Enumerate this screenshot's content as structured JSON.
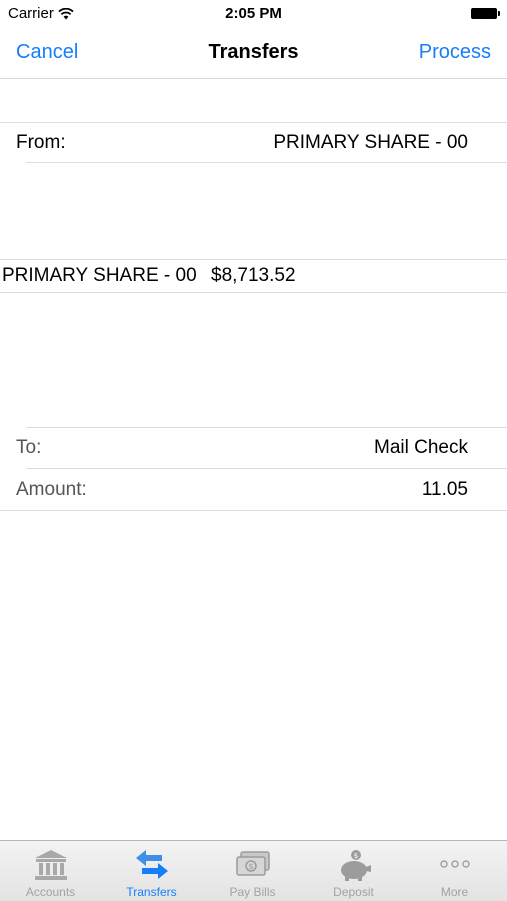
{
  "status_bar": {
    "carrier": "Carrier",
    "time": "2:05 PM"
  },
  "nav": {
    "cancel_label": "Cancel",
    "title": "Transfers",
    "process_label": "Process"
  },
  "from": {
    "label": "From:",
    "value": "PRIMARY SHARE - 00"
  },
  "picker": {
    "account_name": "PRIMARY SHARE - 00",
    "balance": "$8,713.52"
  },
  "to": {
    "label": "To:",
    "value": "Mail Check"
  },
  "amount": {
    "label": "Amount:",
    "value": "11.05"
  },
  "tabs": [
    {
      "label": "Accounts",
      "icon": "bank-icon",
      "active": false
    },
    {
      "label": "Transfers",
      "icon": "transfer-arrows-icon",
      "active": true
    },
    {
      "label": "Pay Bills",
      "icon": "cash-icon",
      "active": false
    },
    {
      "label": "Deposit",
      "icon": "piggy-bank-icon",
      "active": false
    },
    {
      "label": "More",
      "icon": "more-dots-icon",
      "active": false
    }
  ],
  "colors": {
    "accent": "#157efb",
    "inactive_tab": "#a2a2a2"
  }
}
